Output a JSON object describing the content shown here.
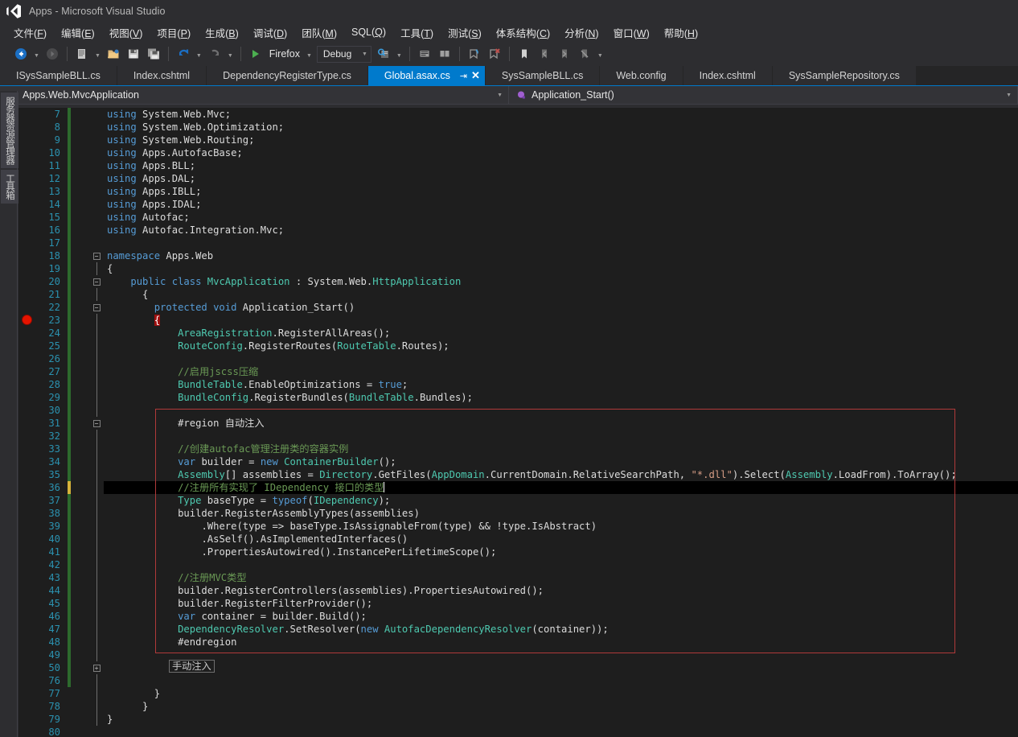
{
  "window": {
    "title": "Apps - Microsoft Visual Studio",
    "logo_icon": "visual-studio-logo"
  },
  "menubar": {
    "items": [
      {
        "label": "文件",
        "mnemonic": "F"
      },
      {
        "label": "编辑",
        "mnemonic": "E"
      },
      {
        "label": "视图",
        "mnemonic": "V"
      },
      {
        "label": "项目",
        "mnemonic": "P"
      },
      {
        "label": "生成",
        "mnemonic": "B"
      },
      {
        "label": "调试",
        "mnemonic": "D"
      },
      {
        "label": "团队",
        "mnemonic": "M"
      },
      {
        "label": "SQL",
        "mnemonic": "Q"
      },
      {
        "label": "工具",
        "mnemonic": "T"
      },
      {
        "label": "测试",
        "mnemonic": "S"
      },
      {
        "label": "体系结构",
        "mnemonic": "C"
      },
      {
        "label": "分析",
        "mnemonic": "N"
      },
      {
        "label": "窗口",
        "mnemonic": "W"
      },
      {
        "label": "帮助",
        "mnemonic": "H"
      }
    ]
  },
  "toolbar": {
    "navigate_back_icon": "navigate-back-icon",
    "navigate_forward_icon": "navigate-forward-icon",
    "new_item_icon": "new-item-icon",
    "open_file_icon": "open-file-icon",
    "save_icon": "save-icon",
    "save_all_icon": "save-all-icon",
    "undo_icon": "undo-icon",
    "redo_icon": "redo-icon",
    "start_debug_icon": "start-debug-play-icon",
    "start_debug_label": "Firefox",
    "config_label": "Debug",
    "find_icon": "find-in-files-icon",
    "comment_icon": "comment-selection-icon",
    "uncomment_icon": "uncomment-selection-icon",
    "add_bookmark_icon": "add-bookmark-icon",
    "remove_bookmark_icon": "remove-bookmark-icon",
    "toggle_bookmark_icon": "toggle-bookmark-icon",
    "prev_bookmark_icon": "previous-bookmark-icon",
    "next_bookmark_icon": "next-bookmark-icon",
    "clear_bookmarks_icon": "clear-bookmarks-icon",
    "overflow_icon": "toolbar-overflow-icon"
  },
  "left_dock": {
    "tabs": [
      {
        "label": "服务器资源管理器"
      },
      {
        "label": "工具箱"
      }
    ]
  },
  "tabs": [
    {
      "label": "ISysSampleBLL.cs",
      "active": false
    },
    {
      "label": "Index.cshtml",
      "active": false
    },
    {
      "label": "DependencyRegisterType.cs",
      "active": false
    },
    {
      "label": "Global.asax.cs",
      "active": true
    },
    {
      "label": "SysSampleBLL.cs",
      "active": false
    },
    {
      "label": "Web.config",
      "active": false
    },
    {
      "label": "Index.cshtml",
      "active": false
    },
    {
      "label": "SysSampleRepository.cs",
      "active": false
    }
  ],
  "tab_actions": {
    "pin_icon": "pin-tab-icon",
    "close_icon": "close-tab-icon"
  },
  "navbar": {
    "type_icon": "class-icon",
    "type_name": "Apps.Web.MvcApplication",
    "member_icon": "method-icon",
    "member_name": "Application_Start()",
    "caret_icon": "chevron-down-icon"
  },
  "editor": {
    "collapsed_region_label": "手动注入",
    "caret_line": 36,
    "breakpoint_line": 23,
    "lines": [
      {
        "n": 7,
        "indent": 0,
        "tokens": [
          [
            "k",
            "using "
          ],
          [
            "pl",
            "System.Web.Mvc;"
          ]
        ],
        "mark": "saved"
      },
      {
        "n": 8,
        "indent": 0,
        "tokens": [
          [
            "k",
            "using "
          ],
          [
            "pl",
            "System.Web.Optimization;"
          ]
        ],
        "mark": "saved"
      },
      {
        "n": 9,
        "indent": 0,
        "tokens": [
          [
            "k",
            "using "
          ],
          [
            "pl",
            "System.Web.Routing;"
          ]
        ],
        "mark": "saved"
      },
      {
        "n": 10,
        "indent": 0,
        "tokens": [
          [
            "k",
            "using "
          ],
          [
            "pl",
            "Apps.AutofacBase;"
          ]
        ],
        "mark": "saved"
      },
      {
        "n": 11,
        "indent": 0,
        "tokens": [
          [
            "k",
            "using "
          ],
          [
            "pl",
            "Apps.BLL;"
          ]
        ],
        "mark": "saved"
      },
      {
        "n": 12,
        "indent": 0,
        "tokens": [
          [
            "k",
            "using "
          ],
          [
            "pl",
            "Apps.DAL;"
          ]
        ],
        "mark": "saved"
      },
      {
        "n": 13,
        "indent": 0,
        "tokens": [
          [
            "k",
            "using "
          ],
          [
            "pl",
            "Apps.IBLL;"
          ]
        ],
        "mark": "saved"
      },
      {
        "n": 14,
        "indent": 0,
        "tokens": [
          [
            "k",
            "using "
          ],
          [
            "pl",
            "Apps.IDAL;"
          ]
        ],
        "mark": "saved"
      },
      {
        "n": 15,
        "indent": 0,
        "tokens": [
          [
            "k",
            "using "
          ],
          [
            "pl",
            "Autofac;"
          ]
        ],
        "mark": "saved"
      },
      {
        "n": 16,
        "indent": 0,
        "tokens": [
          [
            "k",
            "using "
          ],
          [
            "pl",
            "Autofac.Integration.Mvc;"
          ]
        ],
        "mark": "saved"
      },
      {
        "n": 17,
        "indent": 0,
        "tokens": [
          [
            "pl",
            ""
          ]
        ],
        "mark": "saved"
      },
      {
        "n": 18,
        "indent": 0,
        "glyph": "minus",
        "tokens": [
          [
            "k",
            "namespace "
          ],
          [
            "pl",
            "Apps.Web"
          ]
        ],
        "mark": "saved"
      },
      {
        "n": 19,
        "indent": 0,
        "tokens": [
          [
            "pl",
            "{"
          ]
        ],
        "mark": "saved"
      },
      {
        "n": 20,
        "indent": 2,
        "glyph": "minus",
        "tokens": [
          [
            "k",
            "public "
          ],
          [
            "k",
            "class "
          ],
          [
            "kc",
            "MvcApplication"
          ],
          [
            "pl",
            " : "
          ],
          [
            "pl",
            "System.Web."
          ],
          [
            "kc",
            "HttpApplication"
          ]
        ],
        "mark": "saved"
      },
      {
        "n": 21,
        "indent": 3,
        "tokens": [
          [
            "pl",
            "{"
          ]
        ],
        "mark": "saved"
      },
      {
        "n": 22,
        "indent": 4,
        "glyph": "minus",
        "tokens": [
          [
            "k",
            "protected "
          ],
          [
            "k",
            "void "
          ],
          [
            "pl",
            "Application_Start()"
          ]
        ],
        "mark": "saved"
      },
      {
        "n": 23,
        "indent": 4,
        "tokens": [
          [
            "bphl",
            "{"
          ]
        ],
        "mark": "saved",
        "breakpoint": true
      },
      {
        "n": 24,
        "indent": 6,
        "tokens": [
          [
            "kc",
            "AreaRegistration"
          ],
          [
            "pl",
            ".RegisterAllAreas();"
          ]
        ],
        "mark": "saved"
      },
      {
        "n": 25,
        "indent": 6,
        "tokens": [
          [
            "kc",
            "RouteConfig"
          ],
          [
            "pl",
            ".RegisterRoutes("
          ],
          [
            "kc",
            "RouteTable"
          ],
          [
            "pl",
            ".Routes);"
          ]
        ],
        "mark": "saved"
      },
      {
        "n": 26,
        "indent": 0,
        "tokens": [
          [
            "pl",
            ""
          ]
        ],
        "mark": "saved"
      },
      {
        "n": 27,
        "indent": 6,
        "tokens": [
          [
            "cm",
            "//启用jscss压缩"
          ]
        ],
        "mark": "saved"
      },
      {
        "n": 28,
        "indent": 6,
        "tokens": [
          [
            "kc",
            "BundleTable"
          ],
          [
            "pl",
            ".EnableOptimizations = "
          ],
          [
            "k",
            "true"
          ],
          [
            "pl",
            ";"
          ]
        ],
        "mark": "saved"
      },
      {
        "n": 29,
        "indent": 6,
        "tokens": [
          [
            "kc",
            "BundleConfig"
          ],
          [
            "pl",
            ".RegisterBundles("
          ],
          [
            "kc",
            "BundleTable"
          ],
          [
            "pl",
            ".Bundles);"
          ]
        ],
        "mark": "saved"
      },
      {
        "n": 30,
        "indent": 0,
        "tokens": [
          [
            "pl",
            ""
          ]
        ],
        "mark": "saved"
      },
      {
        "n": 31,
        "indent": 6,
        "glyph": "minus",
        "tokens": [
          [
            "pl",
            "#region 自动注入"
          ]
        ],
        "mark": "saved"
      },
      {
        "n": 32,
        "indent": 0,
        "tokens": [
          [
            "pl",
            ""
          ]
        ],
        "mark": "saved"
      },
      {
        "n": 33,
        "indent": 6,
        "tokens": [
          [
            "cm",
            "//创建autofac管理注册类的容器实例"
          ]
        ],
        "mark": "saved"
      },
      {
        "n": 34,
        "indent": 6,
        "tokens": [
          [
            "k",
            "var "
          ],
          [
            "pl",
            "builder = "
          ],
          [
            "k",
            "new "
          ],
          [
            "kc",
            "ContainerBuilder"
          ],
          [
            "pl",
            "();"
          ]
        ],
        "mark": "saved"
      },
      {
        "n": 35,
        "indent": 6,
        "tokens": [
          [
            "kc",
            "Assembly"
          ],
          [
            "pl",
            "[] assemblies = "
          ],
          [
            "kc",
            "Directory"
          ],
          [
            "pl",
            ".GetFiles("
          ],
          [
            "kc",
            "AppDomain"
          ],
          [
            "pl",
            ".CurrentDomain.RelativeSearchPath, "
          ],
          [
            "st",
            "\"*.dll\""
          ],
          [
            "pl",
            ").Select("
          ],
          [
            "kc",
            "Assembly"
          ],
          [
            "pl",
            ".LoadFrom).ToArray();"
          ]
        ],
        "mark": "saved"
      },
      {
        "n": 36,
        "indent": 6,
        "tokens": [
          [
            "cm",
            "//注册所有实现了 IDependency 接口的类型"
          ]
        ],
        "mark": "unsaved",
        "current": true,
        "caret": true
      },
      {
        "n": 37,
        "indent": 6,
        "tokens": [
          [
            "kc",
            "Type "
          ],
          [
            "pl",
            "baseType = "
          ],
          [
            "k",
            "typeof"
          ],
          [
            "pl",
            "("
          ],
          [
            "kc",
            "IDependency"
          ],
          [
            "pl",
            ");"
          ]
        ],
        "mark": "saved"
      },
      {
        "n": 38,
        "indent": 6,
        "tokens": [
          [
            "pl",
            "builder.RegisterAssemblyTypes(assemblies)"
          ]
        ],
        "mark": "saved"
      },
      {
        "n": 39,
        "indent": 8,
        "tokens": [
          [
            "pl",
            ".Where(type => baseType.IsAssignableFrom(type) && !type.IsAbstract)"
          ]
        ],
        "mark": "saved"
      },
      {
        "n": 40,
        "indent": 8,
        "tokens": [
          [
            "pl",
            ".AsSelf().AsImplementedInterfaces()"
          ]
        ],
        "mark": "saved"
      },
      {
        "n": 41,
        "indent": 8,
        "tokens": [
          [
            "pl",
            ".PropertiesAutowired().InstancePerLifetimeScope();"
          ]
        ],
        "mark": "saved"
      },
      {
        "n": 42,
        "indent": 0,
        "tokens": [
          [
            "pl",
            ""
          ]
        ],
        "mark": "saved"
      },
      {
        "n": 43,
        "indent": 6,
        "tokens": [
          [
            "cm",
            "//注册MVC类型"
          ]
        ],
        "mark": "saved"
      },
      {
        "n": 44,
        "indent": 6,
        "tokens": [
          [
            "pl",
            "builder.RegisterControllers(assemblies).PropertiesAutowired();"
          ]
        ],
        "mark": "saved"
      },
      {
        "n": 45,
        "indent": 6,
        "tokens": [
          [
            "pl",
            "builder.RegisterFilterProvider();"
          ]
        ],
        "mark": "saved"
      },
      {
        "n": 46,
        "indent": 6,
        "tokens": [
          [
            "k",
            "var "
          ],
          [
            "pl",
            "container = builder.Build();"
          ]
        ],
        "mark": "saved"
      },
      {
        "n": 47,
        "indent": 6,
        "tokens": [
          [
            "kc",
            "DependencyResolver"
          ],
          [
            "pl",
            ".SetResolver("
          ],
          [
            "k",
            "new "
          ],
          [
            "kc",
            "AutofacDependencyResolver"
          ],
          [
            "pl",
            "(container));"
          ]
        ],
        "mark": "saved"
      },
      {
        "n": 48,
        "indent": 6,
        "tokens": [
          [
            "pl",
            "#endregion"
          ]
        ],
        "mark": "saved"
      },
      {
        "n": 49,
        "indent": 0,
        "tokens": [
          [
            "pl",
            ""
          ]
        ],
        "mark": "saved"
      },
      {
        "n": 50,
        "indent": 6,
        "glyph": "plus",
        "tokens": [
          [
            "collapsed",
            ""
          ]
        ],
        "mark": "saved"
      },
      {
        "n": 76,
        "indent": 0,
        "tokens": [
          [
            "pl",
            ""
          ]
        ],
        "mark": "saved"
      },
      {
        "n": 77,
        "indent": 4,
        "tokens": [
          [
            "pl",
            "}"
          ]
        ],
        "mark": ""
      },
      {
        "n": 78,
        "indent": 3,
        "tokens": [
          [
            "pl",
            "}"
          ]
        ],
        "mark": ""
      },
      {
        "n": 79,
        "indent": 0,
        "tokens": [
          [
            "pl",
            "}"
          ]
        ],
        "mark": ""
      },
      {
        "n": 80,
        "indent": 0,
        "tokens": [
          [
            "pl",
            ""
          ]
        ],
        "mark": ""
      }
    ]
  },
  "colors": {
    "accent": "#007acc",
    "chrome": "#2d2d30",
    "editor_bg": "#1e1e1e",
    "keyword": "#569cd6",
    "type": "#4ec9b0",
    "comment": "#6a9955",
    "string": "#d69d85",
    "linenumber": "#2b91af",
    "breakpoint": "#e51400",
    "region_border": "#b03a3a"
  }
}
